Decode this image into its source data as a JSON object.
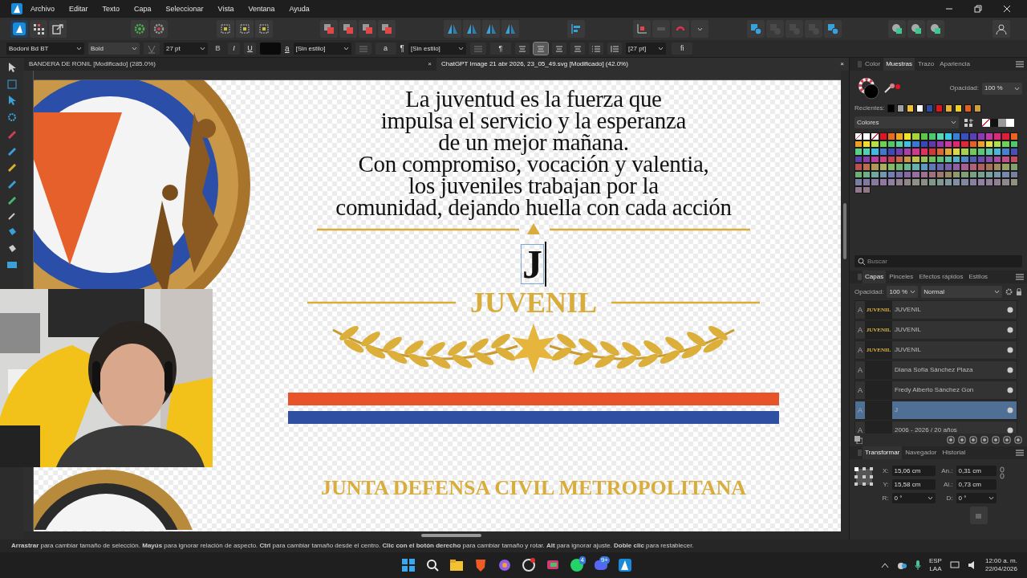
{
  "menu_bar": {
    "items": [
      "Archivo",
      "Editar",
      "Texto",
      "Capa",
      "Seleccionar",
      "Vista",
      "Ventana",
      "Ayuda"
    ]
  },
  "context_bar": {
    "font": "Bodoni Bd BT",
    "weight": "Bold",
    "size": "27 pt",
    "format_buttons": [
      {
        "label": "B",
        "disabled": true
      },
      {
        "label": "I",
        "disabled": false
      },
      {
        "label": "U",
        "disabled": false
      }
    ],
    "text_color": {
      "color": "#0a0a0a"
    },
    "char_glyph": "a",
    "char_style": "[Sin estilo]",
    "char_button": "a",
    "pilcrow": "¶",
    "para_style": "[Sin estilo]",
    "para_button": "¶",
    "align": [
      {
        "selected": false
      },
      {
        "selected": true
      },
      {
        "selected": false
      },
      {
        "selected": false
      }
    ],
    "leading": "[27 pt]",
    "ligature": "fi"
  },
  "doc_tabs": [
    {
      "title": "BANDERA DE RONIL [Modificado] (285.0%)",
      "close": "×",
      "selected": false
    },
    {
      "title": "ChatGPT Image 21 abr 2026, 23_05_49.svg [Modificado] (42.0%)",
      "close": "×",
      "selected": true
    }
  ],
  "document": {
    "paragraph": [
      "La juventud es la fuerza que",
      "impulsa el servicio y la esperanza",
      "de un mejor mañana.",
      "Con compromiso, vocación y valentia,",
      "los juveniles trabajan por la",
      "comunidad, dejando huella con cada acción"
    ],
    "initial": "J",
    "title": "JUVENIL",
    "stripes": [
      {
        "color": "#e8542a"
      },
      {
        "color": "#2f4fa3"
      }
    ],
    "footer": "JUNTA DEFENSA CIVIL METROPOLITANA"
  },
  "swatches_panel": {
    "tabs": [
      {
        "label": "Color",
        "selected": false
      },
      {
        "label": "Muestras",
        "selected": true
      },
      {
        "label": "Trazo",
        "selected": false
      },
      {
        "label": "Apariencia",
        "selected": false
      }
    ],
    "opacity_label": "Opacidad:",
    "opacity": "100 %",
    "recent_label": "Recientes:",
    "recent": [
      {
        "color": "#000000"
      },
      {
        "color": "#a0a0a0"
      },
      {
        "color": "#f0c030"
      },
      {
        "color": "#ffffff"
      },
      {
        "color": "#2f4fa3"
      },
      {
        "color": "#e3141f"
      },
      {
        "color": "#e8b030"
      },
      {
        "color": "#f0d020"
      },
      {
        "color": "#e86020"
      },
      {
        "color": "#d0a040"
      }
    ],
    "palette": "Colores",
    "quick": [
      {
        "kind": "none"
      },
      {
        "kind": "fill",
        "color": "#111111"
      },
      {
        "kind": "fill",
        "color": "#999999"
      },
      {
        "kind": "fill",
        "color": "#ffffff"
      }
    ],
    "swatches": [
      {
        "kind": "none"
      },
      {
        "kind": "fill",
        "color": "#ffffff"
      },
      {
        "kind": "none"
      },
      {
        "kind": "fill",
        "color": "#e3141f"
      },
      {
        "kind": "fill",
        "color": "#ea6a1f"
      },
      {
        "kind": "fill",
        "color": "#f2a81d"
      },
      {
        "kind": "fill",
        "color": "#f2e41d"
      },
      {
        "kind": "fill",
        "color": "#a4d63a"
      },
      {
        "kind": "fill",
        "color": "#5cc84a"
      },
      {
        "kind": "fill",
        "color": "#4cc870"
      },
      {
        "kind": "fill",
        "color": "#5ed6b0"
      },
      {
        "kind": "fill",
        "color": "#3cc8e6"
      },
      {
        "kind": "fill",
        "color": "#3a7fd6"
      },
      {
        "kind": "fill",
        "color": "#3a4fc0"
      },
      {
        "kind": "fill",
        "color": "#5a3fb8"
      },
      {
        "kind": "fill",
        "color": "#8a3ab4"
      },
      {
        "kind": "fill",
        "color": "#c23aa8"
      },
      {
        "kind": "fill",
        "color": "#e0287a"
      },
      {
        "kind": "fill",
        "color": "#e01e3c"
      },
      {
        "kind": "fill",
        "color": "#e86420"
      },
      {
        "kind": "fill",
        "color": "#f0a020"
      },
      {
        "kind": "fill",
        "color": "#eedd30"
      },
      {
        "kind": "fill",
        "color": "#b8e040"
      },
      {
        "kind": "fill",
        "color": "#70d050"
      },
      {
        "kind": "fill",
        "color": "#50c868"
      },
      {
        "kind": "fill",
        "color": "#58d0a0"
      },
      {
        "kind": "fill",
        "color": "#40c0e0"
      },
      {
        "kind": "fill",
        "color": "#3a78d0"
      },
      {
        "kind": "fill",
        "color": "#3848b8"
      },
      {
        "kind": "fill",
        "color": "#6038b0"
      },
      {
        "kind": "fill",
        "color": "#9838b0"
      },
      {
        "kind": "fill",
        "color": "#c83aa0"
      },
      {
        "kind": "fill",
        "color": "#e02870"
      },
      {
        "kind": "fill",
        "color": "#e02838"
      },
      {
        "kind": "fill",
        "color": "#e86028"
      },
      {
        "kind": "fill",
        "color": "#f0a028"
      },
      {
        "kind": "fill",
        "color": "#e8e040"
      },
      {
        "kind": "fill",
        "color": "#b0e048"
      },
      {
        "kind": "fill",
        "color": "#70d058"
      },
      {
        "kind": "fill",
        "color": "#50c870"
      },
      {
        "kind": "fill",
        "color": "#58d080"
      },
      {
        "kind": "fill",
        "color": "#50d0b0"
      },
      {
        "kind": "fill",
        "color": "#40b8e0"
      },
      {
        "kind": "fill",
        "color": "#4078d0"
      },
      {
        "kind": "fill",
        "color": "#4048b8"
      },
      {
        "kind": "fill",
        "color": "#7040b0"
      },
      {
        "kind": "fill",
        "color": "#a840a8"
      },
      {
        "kind": "fill",
        "color": "#d03890"
      },
      {
        "kind": "fill",
        "color": "#e03060"
      },
      {
        "kind": "fill",
        "color": "#d03838"
      },
      {
        "kind": "fill",
        "color": "#d86838"
      },
      {
        "kind": "fill",
        "color": "#e0a838"
      },
      {
        "kind": "fill",
        "color": "#d8d848"
      },
      {
        "kind": "fill",
        "color": "#a8d050"
      },
      {
        "kind": "fill",
        "color": "#70c858"
      },
      {
        "kind": "fill",
        "color": "#58c878"
      },
      {
        "kind": "fill",
        "color": "#58c8a8"
      },
      {
        "kind": "fill",
        "color": "#48b8d8"
      },
      {
        "kind": "fill",
        "color": "#4880d0"
      },
      {
        "kind": "fill",
        "color": "#4850b8"
      },
      {
        "kind": "fill",
        "color": "#6040b0"
      },
      {
        "kind": "fill",
        "color": "#8840a8"
      },
      {
        "kind": "fill",
        "color": "#b840a0"
      },
      {
        "kind": "fill",
        "color": "#d04080"
      },
      {
        "kind": "fill",
        "color": "#c84050"
      },
      {
        "kind": "fill",
        "color": "#c86848"
      },
      {
        "kind": "fill",
        "color": "#c89848"
      },
      {
        "kind": "fill",
        "color": "#c0c050"
      },
      {
        "kind": "fill",
        "color": "#98c058"
      },
      {
        "kind": "fill",
        "color": "#70c060"
      },
      {
        "kind": "fill",
        "color": "#60c078"
      },
      {
        "kind": "fill",
        "color": "#60c0a0"
      },
      {
        "kind": "fill",
        "color": "#58b0c8"
      },
      {
        "kind": "fill",
        "color": "#5088c8"
      },
      {
        "kind": "fill",
        "color": "#5060b8"
      },
      {
        "kind": "fill",
        "color": "#6850b0"
      },
      {
        "kind": "fill",
        "color": "#8850a8"
      },
      {
        "kind": "fill",
        "color": "#a850a0"
      },
      {
        "kind": "fill",
        "color": "#c05088"
      },
      {
        "kind": "fill",
        "color": "#c05060"
      },
      {
        "kind": "fill",
        "color": "#b85050"
      },
      {
        "kind": "fill",
        "color": "#b87050"
      },
      {
        "kind": "fill",
        "color": "#b09858"
      },
      {
        "kind": "fill",
        "color": "#a8b060"
      },
      {
        "kind": "fill",
        "color": "#88b868"
      },
      {
        "kind": "fill",
        "color": "#70b870"
      },
      {
        "kind": "fill",
        "color": "#68b890"
      },
      {
        "kind": "fill",
        "color": "#68b0b0"
      },
      {
        "kind": "fill",
        "color": "#6098c0"
      },
      {
        "kind": "fill",
        "color": "#6078b8"
      },
      {
        "kind": "fill",
        "color": "#6868b0"
      },
      {
        "kind": "fill",
        "color": "#7860a8"
      },
      {
        "kind": "fill",
        "color": "#9060a0"
      },
      {
        "kind": "fill",
        "color": "#a86090"
      },
      {
        "kind": "fill",
        "color": "#b06078"
      },
      {
        "kind": "fill",
        "color": "#b06060"
      },
      {
        "kind": "fill",
        "color": "#a87058"
      },
      {
        "kind": "fill",
        "color": "#a08c60"
      },
      {
        "kind": "fill",
        "color": "#98a068"
      },
      {
        "kind": "fill",
        "color": "#80a070"
      },
      {
        "kind": "fill",
        "color": "#70b070"
      },
      {
        "kind": "fill",
        "color": "#70b088"
      },
      {
        "kind": "fill",
        "color": "#70a8a0"
      },
      {
        "kind": "fill",
        "color": "#7098b0"
      },
      {
        "kind": "fill",
        "color": "#7080b0"
      },
      {
        "kind": "fill",
        "color": "#7870a8"
      },
      {
        "kind": "fill",
        "color": "#8868a0"
      },
      {
        "kind": "fill",
        "color": "#9870a0"
      },
      {
        "kind": "fill",
        "color": "#a07090"
      },
      {
        "kind": "fill",
        "color": "#a07080"
      },
      {
        "kind": "fill",
        "color": "#a07870"
      },
      {
        "kind": "fill",
        "color": "#988868"
      },
      {
        "kind": "fill",
        "color": "#909870"
      },
      {
        "kind": "fill",
        "color": "#80a078"
      },
      {
        "kind": "fill",
        "color": "#78a080"
      },
      {
        "kind": "fill",
        "color": "#78a090"
      },
      {
        "kind": "fill",
        "color": "#78a0a0"
      },
      {
        "kind": "fill",
        "color": "#7898a8"
      },
      {
        "kind": "fill",
        "color": "#7888a8"
      },
      {
        "kind": "fill",
        "color": "#7880a0"
      },
      {
        "kind": "fill",
        "color": "#7880a1"
      },
      {
        "kind": "fill",
        "color": "#8078a0"
      },
      {
        "kind": "fill",
        "color": "#8878a0"
      },
      {
        "kind": "fill",
        "color": "#9078a0"
      },
      {
        "kind": "fill",
        "color": "#9080a0"
      },
      {
        "kind": "fill",
        "color": "#908090"
      },
      {
        "kind": "fill",
        "color": "#908888"
      },
      {
        "kind": "fill",
        "color": "#909088"
      },
      {
        "kind": "fill",
        "color": "#889088"
      },
      {
        "kind": "fill",
        "color": "#809888"
      },
      {
        "kind": "fill",
        "color": "#809890"
      },
      {
        "kind": "fill",
        "color": "#8098a0"
      },
      {
        "kind": "fill",
        "color": "#8090a0"
      },
      {
        "kind": "fill",
        "color": "#8088a0"
      },
      {
        "kind": "fill",
        "color": "#8880a0"
      },
      {
        "kind": "fill",
        "color": "#9080a1"
      },
      {
        "kind": "fill",
        "color": "#908098"
      },
      {
        "kind": "fill",
        "color": "#908091"
      },
      {
        "kind": "fill",
        "color": "#908889"
      },
      {
        "kind": "fill",
        "color": "#909080"
      },
      {
        "kind": "fill",
        "color": "#907890"
      },
      {
        "kind": "fill",
        "color": "#907888"
      }
    ],
    "search_placeholder": "Buscar"
  },
  "layers_panel": {
    "tabs": [
      {
        "label": "Capas",
        "selected": true
      },
      {
        "label": "Pinceles",
        "selected": false
      },
      {
        "label": "Efectos rápidos",
        "selected": false
      },
      {
        "label": "Estilos",
        "selected": false
      }
    ],
    "opacity_label": "Opacidad:",
    "opacity": "100 %",
    "blend": "Normal",
    "layers": [
      {
        "glyph": "A",
        "thumb": "JUVENIL",
        "name": "JUVENIL",
        "selected": false
      },
      {
        "glyph": "A",
        "thumb": "JUVENIL",
        "name": "JUVENIL",
        "selected": false
      },
      {
        "glyph": "A",
        "thumb": "JUVENIL",
        "name": "JUVENIL",
        "selected": false
      },
      {
        "glyph": "A",
        "name": "Diana Sofía Sánchez Plaza",
        "selected": false
      },
      {
        "glyph": "A",
        "name": "Fredy Alberto Sánchez Gon",
        "selected": false
      },
      {
        "glyph": "A",
        "name": "J",
        "selected": true
      },
      {
        "glyph": "A",
        "name": "2006 - 2026 / 20 años",
        "selected": false
      }
    ]
  },
  "transform_panel": {
    "tabs": [
      {
        "label": "Transformar",
        "selected": true
      },
      {
        "label": "Navegador",
        "selected": false
      },
      {
        "label": "Historial",
        "selected": false
      }
    ],
    "fields": [
      {
        "label": "X:",
        "value": "15,06 cm",
        "kind": "input"
      },
      {
        "label": "An.:",
        "value": "0,31 cm",
        "kind": "input"
      },
      {
        "label": "Y:",
        "value": "15,58 cm",
        "kind": "input"
      },
      {
        "label": "Al.:",
        "value": "0,73 cm",
        "kind": "input"
      },
      {
        "label": "R:",
        "value": "0 °",
        "kind": "select"
      },
      {
        "label": "D:",
        "value": "0 °",
        "kind": "select"
      }
    ]
  },
  "status_bar": {
    "hint": "**Arrastrar** para cambiar tamaño de selección. **Mayús** para ignorar relación de aspecto. **Ctrl** para cambiar tamaño desde el centro. **Clic con el botón derecho** para cambiar tamaño y rotar. **Alt** para ignorar ajuste. **Doble clic** para restablecer."
  },
  "taskbar": {
    "badges": [
      "4",
      "9+"
    ],
    "language": "ESP",
    "layout": "LAA",
    "time": "12:00 a. m.",
    "date": "22/04/2026"
  }
}
